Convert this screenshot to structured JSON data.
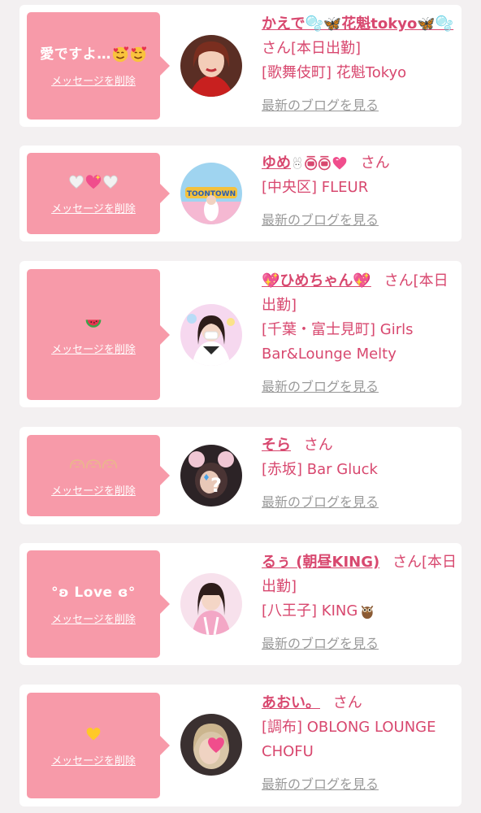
{
  "delete_label": "メッセージを削除",
  "blog_label": "最新のブログを見る",
  "colors": {
    "accent": "#d8486f",
    "bubble": "#f79aa9",
    "link_gray": "#9a9a9a",
    "background": "#f3f0f1"
  },
  "messages": [
    {
      "bubble_text": "愛ですよ…",
      "bubble_icons": [
        "smiling-face-with-hearts-icon",
        "smiling-face-with-hearts-icon"
      ],
      "name": "かえで🫧🦋花魁tokyo🦋🫧",
      "suffix": "さん[本日出勤]",
      "shop": "[歌舞伎町] 花魁Tokyo"
    },
    {
      "bubble_text": "",
      "bubble_icons": [
        "white-heart-icon",
        "sparkling-heart-icon",
        "white-heart-icon"
      ],
      "name": "ゆめ",
      "name_icons": [
        "bunny-face-icon",
        "eyes-icon",
        "heart-icon"
      ],
      "suffix": "さん",
      "shop": "[中央区] FLEUR"
    },
    {
      "bubble_text": "",
      "bubble_icons": [
        "watermelon-icon"
      ],
      "name": "💖ひめちゃん💖",
      "suffix": "さん[本日出勤]",
      "shop": "[千葉・富士見町] Girls Bar&Lounge Melty"
    },
    {
      "bubble_text": "",
      "bubble_icons": [
        "face-emoticon-icon",
        "face-emoticon-icon",
        "face-emoticon-icon"
      ],
      "name": "そら",
      "suffix": "さん",
      "shop": "[赤坂] Bar Gluck"
    },
    {
      "bubble_text": "°ʚ Love ɞ°",
      "bubble_icons": [],
      "name": "るぅ (朝昼KING)",
      "suffix": "さん[本日出勤]",
      "shop": "[八王子] KING",
      "shop_icon": "owl-icon"
    },
    {
      "bubble_text": "",
      "bubble_icons": [
        "yellow-heart-icon"
      ],
      "name": "あおい。",
      "suffix": "さん",
      "shop": "[調布] OBLONG LOUNGE CHOFU"
    }
  ]
}
